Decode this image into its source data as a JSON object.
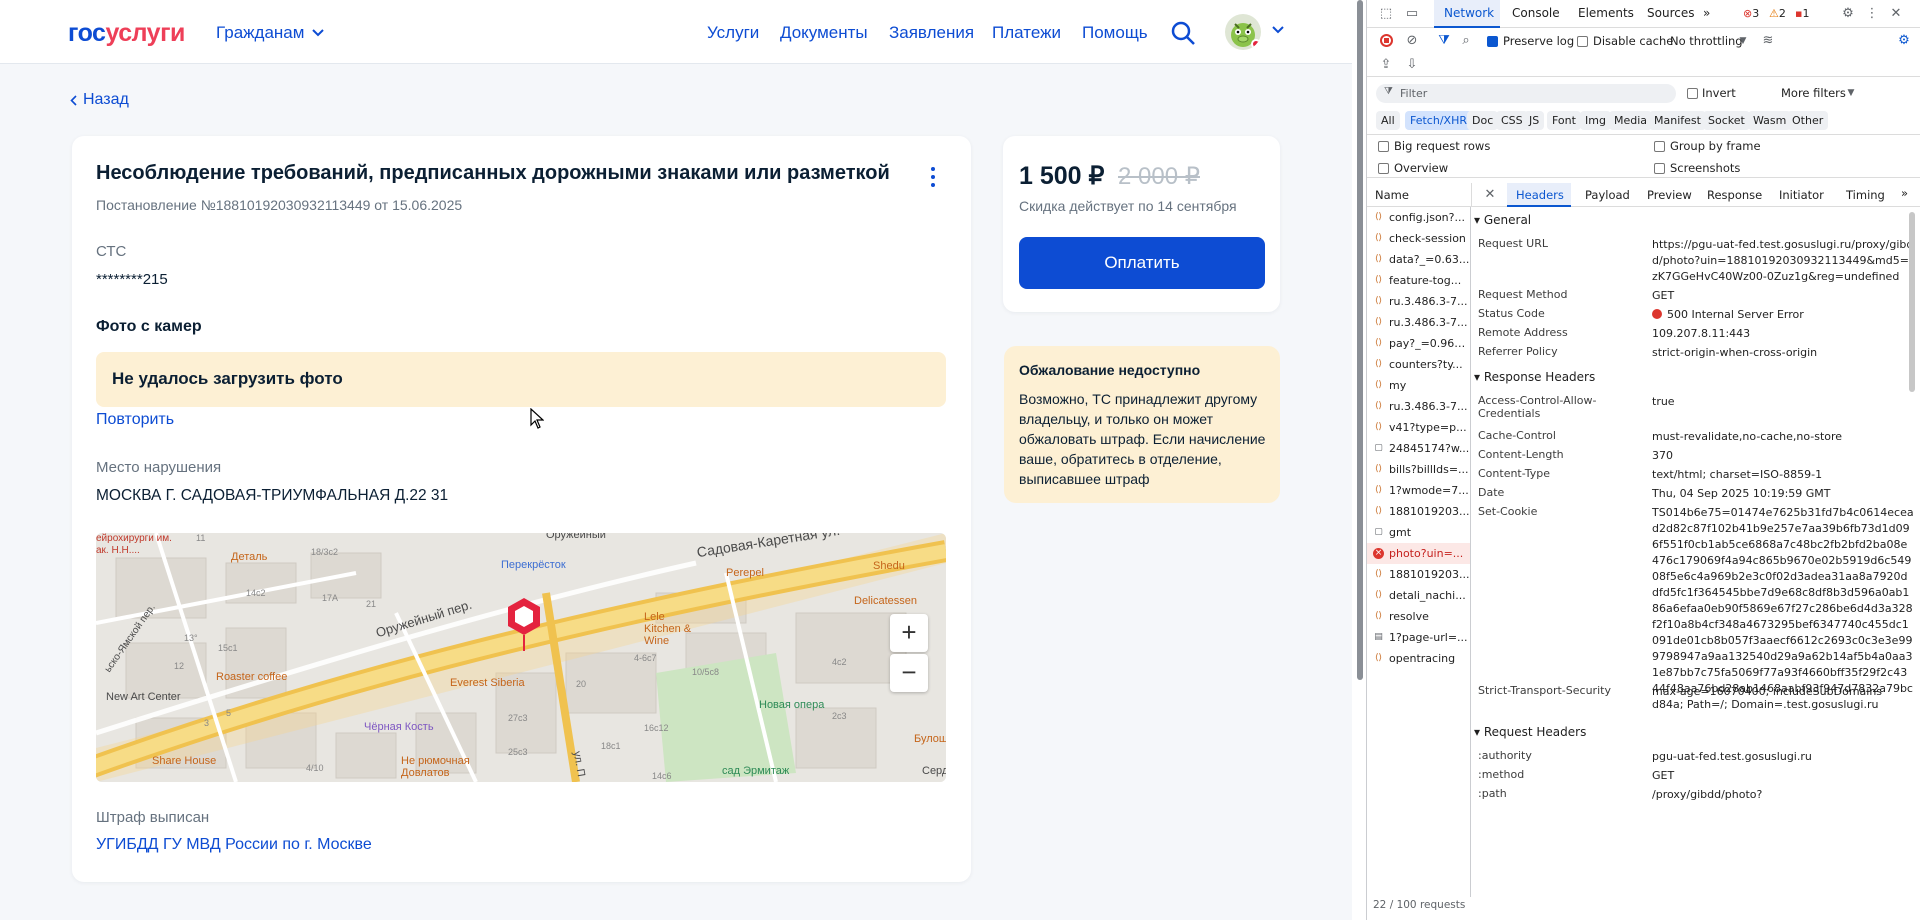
{
  "header": {
    "logo_a": "гос",
    "logo_b": "услуги",
    "role": "Гражданам",
    "nav": [
      "Услуги",
      "Документы",
      "Заявления",
      "Платежи",
      "Помощь"
    ]
  },
  "back_label": "Назад",
  "fine": {
    "title": "Несоблюдение требований, предписанных дорожными знаками или разметкой",
    "subtitle": "Постановление №18810192030932113449 от 15.06.2025",
    "doc_label": "СТС",
    "doc_value": "********215",
    "photo_heading": "Фото с камер",
    "photo_error": "Не удалось загрузить фото",
    "retry": "Повторить",
    "place_label": "Место нарушения",
    "place_value": "МОСКВА Г. САДОВАЯ-ТРИУМФАЛЬНАЯ Д.22 31",
    "issuer_label": "Штраф выписан",
    "issuer_value": "УГИБДД ГУ МВД России по г. Москве"
  },
  "map": {
    "zoom_in": "+",
    "zoom_out": "−",
    "labels": [
      "Оружейный",
      "Садовая-Каретная ул.",
      "Перекрёсток",
      "Perepel",
      "Shedu",
      "Деталь",
      "Оружейный пер.",
      "Lele Kitchen & Wine",
      "Delicatessen",
      "Roaster coffee",
      "Everest Siberia",
      "Новая опера",
      "New Art Center",
      "Чёрная Кость",
      "Share House",
      "Не рюмочная Довлатов",
      "сад Эрмитаж",
      "Булош",
      "Серд",
      "ул. П",
      "18/3с2",
      "17А",
      "14с2",
      "15с1",
      "13°",
      "20",
      "21",
      "27с3",
      "25с3",
      "4/10",
      "18с1",
      "16с12",
      "14с6",
      "10/5с8",
      "4-6с7",
      "4с2",
      "2с3",
      "3",
      "5",
      "11",
      "12",
      "ейрохирурги им. ак. Н.Н....",
      "ьско-Ямской пер."
    ]
  },
  "payment": {
    "price": "1 500 ₽",
    "old_price": "2 000 ₽",
    "discount": "Скидка действует по 14 сентября",
    "pay_button": "Оплатить"
  },
  "appeal": {
    "title": "Обжалование недоступно",
    "text": "Возможно, ТС принадлежит другому владельцу, и только он может обжаловать штраф. Если начисление ваше, обратитесь в отделение, выписавшее штраф"
  },
  "devtools": {
    "tabs": [
      "Network",
      "Console",
      "Elements",
      "Sources"
    ],
    "errors": "3",
    "warnings": "2",
    "issues": "1",
    "preserve_log": "Preserve log",
    "disable_cache": "Disable cache",
    "throttling": "No throttling",
    "filter_placeholder": "Filter",
    "invert": "Invert",
    "more_filters": "More filters",
    "chips": [
      "All",
      "Fetch/XHR",
      "Doc",
      "CSS",
      "JS",
      "Font",
      "Img",
      "Media",
      "Manifest",
      "Socket",
      "Wasm",
      "Other"
    ],
    "big_request_rows": "Big request rows",
    "group_by_frame": "Group by frame",
    "overview": "Overview",
    "screenshots": "Screenshots",
    "name_header": "Name",
    "detail_tabs": [
      "Headers",
      "Payload",
      "Preview",
      "Response",
      "Initiator",
      "Timing"
    ],
    "requests": [
      "config.json?...",
      "check-session",
      "data?_=0.63...",
      "feature-tog...",
      "ru.3.486.3-7...",
      "ru.3.486.3-7...",
      "pay?_=0.966...",
      "counters?ty...",
      "my",
      "ru.3.486.3-7...",
      "v41?type=p...",
      "24845174?w...",
      "bills?billIds=...",
      "1?wmode=7...",
      "1881019203...",
      "gmt",
      "photo?uin=...",
      "1881019203...",
      "detali_nachi...",
      "resolve",
      "1?page-url=...",
      "opentracing"
    ],
    "summary": "22 / 100 requests",
    "general_title": "General",
    "general": [
      {
        "k": "Request URL",
        "v": "https://pgu-uat-fed.test.gosuslugi.ru/proxy/gibdd/photo?uin=18810192030932113449&md5=zK7GGeHvC40Wz00-0Zuz1g&reg=undefined"
      },
      {
        "k": "Request Method",
        "v": "GET"
      },
      {
        "k": "Status Code",
        "v": "500 Internal Server Error"
      },
      {
        "k": "Remote Address",
        "v": "109.207.8.11:443"
      },
      {
        "k": "Referrer Policy",
        "v": "strict-origin-when-cross-origin"
      }
    ],
    "response_title": "Response Headers",
    "response": [
      {
        "k": "Access-Control-Allow-Credentials",
        "v": "true"
      },
      {
        "k": "Cache-Control",
        "v": "must-revalidate,no-cache,no-store"
      },
      {
        "k": "Content-Length",
        "v": "370"
      },
      {
        "k": "Content-Type",
        "v": "text/html; charset=ISO-8859-1"
      },
      {
        "k": "Date",
        "v": "Thu, 04 Sep 2025 10:19:59 GMT"
      },
      {
        "k": "Set-Cookie",
        "v": "TS014b6e75=01474e7625b31fd7b4c0614ecead2d82c87f102b41b9e257e7aa39b6fb73d1d096f551f0cb1ab5ce6868a7c48bc2fb2bfd2ba08e476c179069f4a94c865b9670e02b5919d6c54908f5e6c4a969b2e3c0f02d3adea31aa8a7920ddfd5fc1f364545bbe7d9e68c8df8b3d596a0ab186a6efaa0eb90f5869e67f27c286be6d4d3a328f2f10a8b4cf348a4673295bef6347740c455dc1091de01cb8b057f3aaecf6612c2693c0c3e3e999798947a9aa132540d29a9a62b14af5b4a0aa31e87bb7c75fa5069f77a93f4660bff35f29f2c4344f48aa76bd28ab1468aabf93f947d7832a79bcd84a; Path=/; Domain=.test.gosuslugi.ru"
      },
      {
        "k": "Strict-Transport-Security",
        "v": "max-age=16070400; includeSubDomains"
      }
    ],
    "request_title": "Request Headers",
    "request": [
      {
        "k": ":authority",
        "v": "pgu-uat-fed.test.gosuslugi.ru"
      },
      {
        "k": ":method",
        "v": "GET"
      },
      {
        "k": ":path",
        "v": "/proxy/gibdd/photo?"
      }
    ]
  }
}
